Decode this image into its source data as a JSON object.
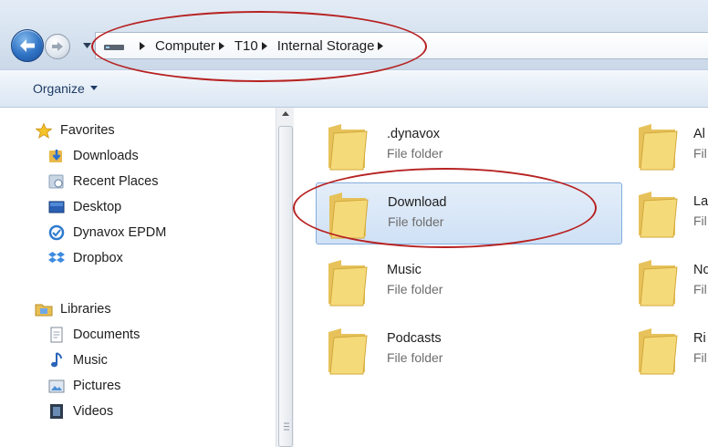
{
  "address_bar": {
    "breadcrumbs": [
      "Computer",
      "T10",
      "Internal Storage"
    ]
  },
  "toolbar": {
    "organize_label": "Organize"
  },
  "nav_pane": {
    "favorites": {
      "label": "Favorites",
      "icon": "star-icon",
      "items": [
        {
          "label": "Downloads",
          "icon": "downloads-icon"
        },
        {
          "label": "Recent Places",
          "icon": "recent-places-icon"
        },
        {
          "label": "Desktop",
          "icon": "desktop-icon"
        },
        {
          "label": "Dynavox EPDM",
          "icon": "dynavox-icon"
        },
        {
          "label": "Dropbox",
          "icon": "dropbox-icon"
        }
      ]
    },
    "libraries": {
      "label": "Libraries",
      "icon": "libraries-icon",
      "items": [
        {
          "label": "Documents",
          "icon": "documents-icon"
        },
        {
          "label": "Music",
          "icon": "music-note-icon"
        },
        {
          "label": "Pictures",
          "icon": "pictures-icon"
        },
        {
          "label": "Videos",
          "icon": "videos-icon"
        }
      ]
    }
  },
  "content": {
    "folders": [
      {
        "name": ".dynavox",
        "type": "File folder",
        "selected": false
      },
      {
        "name": "Download",
        "type": "File folder",
        "selected": true
      },
      {
        "name": "Music",
        "type": "File folder",
        "selected": false
      },
      {
        "name": "Podcasts",
        "type": "File folder",
        "selected": false
      },
      {
        "name": "Al",
        "type": "Fil",
        "selected": false
      },
      {
        "name": "La",
        "type": "Fil",
        "selected": false
      },
      {
        "name": "No",
        "type": "Fil",
        "selected": false
      },
      {
        "name": "Ri",
        "type": "Fil",
        "selected": false
      }
    ]
  },
  "colors": {
    "annotation_ellipse": "#b72222",
    "selection_fill": "#cfe1f5",
    "folder_yellow": "#f3d66e"
  }
}
